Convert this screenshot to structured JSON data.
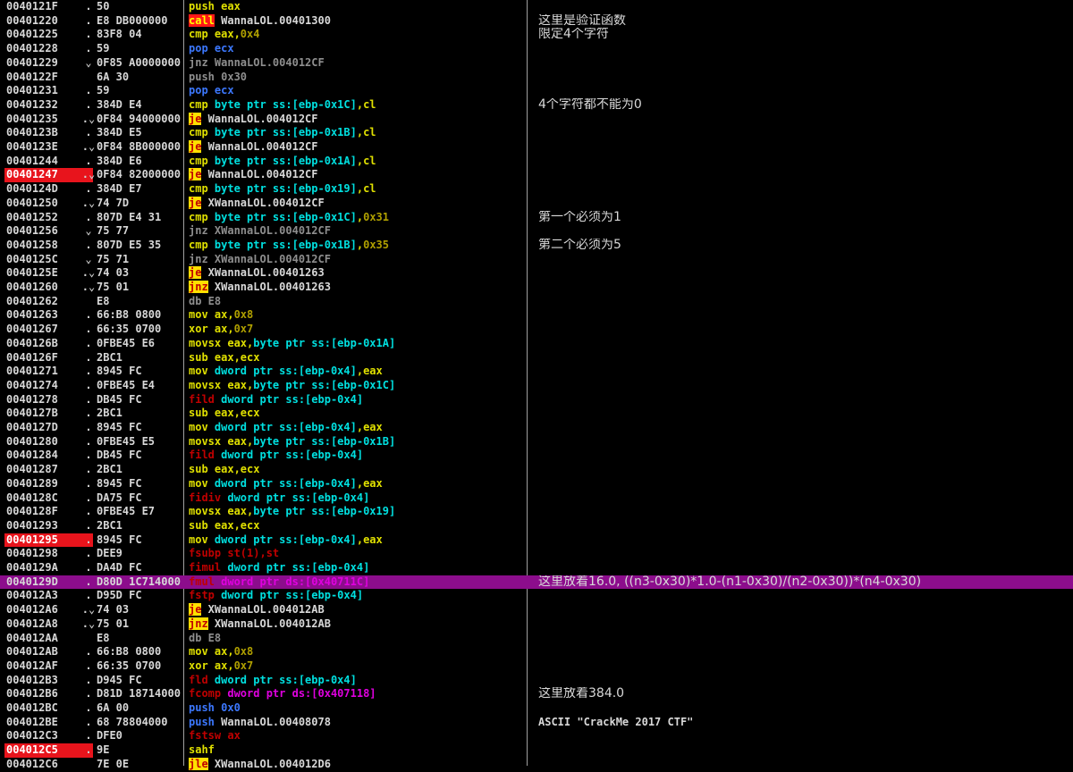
{
  "rows": [
    {
      "addr": "0040121F",
      "mark": ".",
      "hex": "50",
      "ins": [
        [
          "c-y",
          "push eax"
        ]
      ],
      "cmt": ""
    },
    {
      "addr": "00401220",
      "mark": ".",
      "hex": "E8 DB000000",
      "ins": [
        [
          "c-call",
          "call"
        ],
        [
          "c-w",
          " WannaLOL.00401300"
        ]
      ],
      "cmt": "这里是验证函数",
      "cjk": true
    },
    {
      "addr": "00401225",
      "mark": ".",
      "hex": "83F8 04",
      "ins": [
        [
          "c-y",
          "cmp eax,"
        ],
        [
          "c-o",
          "0x4"
        ]
      ],
      "cmt": "限定4个字符",
      "cjk": true
    },
    {
      "addr": "00401228",
      "mark": ".",
      "hex": "59",
      "ins": [
        [
          "c-b",
          "pop ecx"
        ]
      ],
      "cmt": ""
    },
    {
      "addr": "00401229",
      "mark": "⌄",
      "hex": "0F85 A0000000",
      "ins": [
        [
          "c-g",
          "jnz WannaLOL.004012CF"
        ]
      ],
      "cmt": ""
    },
    {
      "addr": "0040122F",
      "mark": "",
      "hex": "6A 30",
      "ins": [
        [
          "c-g",
          "push 0x30"
        ]
      ],
      "cmt": ""
    },
    {
      "addr": "00401231",
      "mark": ".",
      "hex": "59",
      "ins": [
        [
          "c-b",
          "pop ecx"
        ]
      ],
      "cmt": ""
    },
    {
      "addr": "00401232",
      "mark": ".",
      "hex": "384D E4",
      "ins": [
        [
          "c-y",
          "cmp "
        ],
        [
          "c-c",
          "byte ptr ss:[ebp-0x1C]"
        ],
        [
          "c-y",
          ",cl"
        ]
      ],
      "cmt": "4个字符都不能为0",
      "cjk": true
    },
    {
      "addr": "00401235",
      "mark": ".⌄",
      "hex": "0F84 94000000",
      "ins": [
        [
          "c-jy",
          "je"
        ],
        [
          "c-w",
          " WannaLOL.004012CF"
        ]
      ],
      "cmt": ""
    },
    {
      "addr": "0040123B",
      "mark": ".",
      "hex": "384D E5",
      "ins": [
        [
          "c-y",
          "cmp "
        ],
        [
          "c-c",
          "byte ptr ss:[ebp-0x1B]"
        ],
        [
          "c-y",
          ",cl"
        ]
      ],
      "cmt": ""
    },
    {
      "addr": "0040123E",
      "mark": ".⌄",
      "hex": "0F84 8B000000",
      "ins": [
        [
          "c-jy",
          "je"
        ],
        [
          "c-w",
          " WannaLOL.004012CF"
        ]
      ],
      "cmt": ""
    },
    {
      "addr": "00401244",
      "mark": ".",
      "hex": "384D E6",
      "ins": [
        [
          "c-y",
          "cmp "
        ],
        [
          "c-c",
          "byte ptr ss:[ebp-0x1A]"
        ],
        [
          "c-y",
          ",cl"
        ]
      ],
      "cmt": ""
    },
    {
      "addr": "00401247",
      "bp": true,
      "mark": ".⌄",
      "hex": "0F84 82000000",
      "ins": [
        [
          "c-jy",
          "je"
        ],
        [
          "c-w",
          " WannaLOL.004012CF"
        ]
      ],
      "cmt": ""
    },
    {
      "addr": "0040124D",
      "mark": ".",
      "hex": "384D E7",
      "ins": [
        [
          "c-y",
          "cmp "
        ],
        [
          "c-c",
          "byte ptr ss:[ebp-0x19]"
        ],
        [
          "c-y",
          ",cl"
        ]
      ],
      "cmt": ""
    },
    {
      "addr": "00401250",
      "mark": ".⌄",
      "hex": "74 7D",
      "ins": [
        [
          "c-jy",
          "je"
        ],
        [
          "c-w",
          " XWannaLOL.004012CF"
        ]
      ],
      "cmt": ""
    },
    {
      "addr": "00401252",
      "mark": ".",
      "hex": "807D E4 31",
      "ins": [
        [
          "c-y",
          "cmp "
        ],
        [
          "c-c",
          "byte ptr ss:[ebp-0x1C]"
        ],
        [
          "c-y",
          ","
        ],
        [
          "c-o",
          "0x31"
        ]
      ],
      "cmt": "第一个必须为1",
      "cjk": true
    },
    {
      "addr": "00401256",
      "mark": "⌄",
      "hex": "75 77",
      "ins": [
        [
          "c-g",
          "jnz XWannaLOL.004012CF"
        ]
      ],
      "cmt": ""
    },
    {
      "addr": "00401258",
      "mark": ".",
      "hex": "807D E5 35",
      "ins": [
        [
          "c-y",
          "cmp "
        ],
        [
          "c-c",
          "byte ptr ss:[ebp-0x1B]"
        ],
        [
          "c-y",
          ","
        ],
        [
          "c-o",
          "0x35"
        ]
      ],
      "cmt": "第二个必须为5",
      "cjk": true
    },
    {
      "addr": "0040125C",
      "mark": "⌄",
      "hex": "75 71",
      "ins": [
        [
          "c-g",
          "jnz XWannaLOL.004012CF"
        ]
      ],
      "cmt": ""
    },
    {
      "addr": "0040125E",
      "mark": ".⌄",
      "hex": "74 03",
      "ins": [
        [
          "c-jy",
          "je"
        ],
        [
          "c-w",
          " XWannaLOL.00401263"
        ]
      ],
      "cmt": ""
    },
    {
      "addr": "00401260",
      "mark": ".⌄",
      "hex": "75 01",
      "ins": [
        [
          "c-jy",
          "jnz"
        ],
        [
          "c-w",
          " XWannaLOL.00401263"
        ]
      ],
      "cmt": ""
    },
    {
      "addr": "00401262",
      "mark": "",
      "hex": "E8",
      "ins": [
        [
          "c-g",
          "db E8"
        ]
      ],
      "cmt": ""
    },
    {
      "addr": "00401263",
      "mark": ".",
      "hex": "66:B8 0800",
      "ins": [
        [
          "c-y",
          "mov ax,"
        ],
        [
          "c-o",
          "0x8"
        ]
      ],
      "cmt": ""
    },
    {
      "addr": "00401267",
      "mark": ".",
      "hex": "66:35 0700",
      "ins": [
        [
          "c-y",
          "xor ax,"
        ],
        [
          "c-o",
          "0x7"
        ]
      ],
      "cmt": ""
    },
    {
      "addr": "0040126B",
      "mark": ".",
      "hex": "0FBE45 E6",
      "ins": [
        [
          "c-y",
          "movsx eax,"
        ],
        [
          "c-c",
          "byte ptr ss:[ebp-0x1A]"
        ]
      ],
      "cmt": ""
    },
    {
      "addr": "0040126F",
      "mark": ".",
      "hex": "2BC1",
      "ins": [
        [
          "c-y",
          "sub eax,ecx"
        ]
      ],
      "cmt": ""
    },
    {
      "addr": "00401271",
      "mark": ".",
      "hex": "8945 FC",
      "ins": [
        [
          "c-y",
          "mov "
        ],
        [
          "c-c",
          "dword ptr ss:[ebp-0x4]"
        ],
        [
          "c-y",
          ",eax"
        ]
      ],
      "cmt": ""
    },
    {
      "addr": "00401274",
      "mark": ".",
      "hex": "0FBE45 E4",
      "ins": [
        [
          "c-y",
          "movsx eax,"
        ],
        [
          "c-c",
          "byte ptr ss:[ebp-0x1C]"
        ]
      ],
      "cmt": ""
    },
    {
      "addr": "00401278",
      "mark": ".",
      "hex": "DB45 FC",
      "ins": [
        [
          "c-r",
          "fild "
        ],
        [
          "c-c",
          "dword ptr ss:[ebp-0x4]"
        ]
      ],
      "cmt": ""
    },
    {
      "addr": "0040127B",
      "mark": ".",
      "hex": "2BC1",
      "ins": [
        [
          "c-y",
          "sub eax,ecx"
        ]
      ],
      "cmt": ""
    },
    {
      "addr": "0040127D",
      "mark": ".",
      "hex": "8945 FC",
      "ins": [
        [
          "c-y",
          "mov "
        ],
        [
          "c-c",
          "dword ptr ss:[ebp-0x4]"
        ],
        [
          "c-y",
          ",eax"
        ]
      ],
      "cmt": ""
    },
    {
      "addr": "00401280",
      "mark": ".",
      "hex": "0FBE45 E5",
      "ins": [
        [
          "c-y",
          "movsx eax,"
        ],
        [
          "c-c",
          "byte ptr ss:[ebp-0x1B]"
        ]
      ],
      "cmt": ""
    },
    {
      "addr": "00401284",
      "mark": ".",
      "hex": "DB45 FC",
      "ins": [
        [
          "c-r",
          "fild "
        ],
        [
          "c-c",
          "dword ptr ss:[ebp-0x4]"
        ]
      ],
      "cmt": ""
    },
    {
      "addr": "00401287",
      "mark": ".",
      "hex": "2BC1",
      "ins": [
        [
          "c-y",
          "sub eax,ecx"
        ]
      ],
      "cmt": ""
    },
    {
      "addr": "00401289",
      "mark": ".",
      "hex": "8945 FC",
      "ins": [
        [
          "c-y",
          "mov "
        ],
        [
          "c-c",
          "dword ptr ss:[ebp-0x4]"
        ],
        [
          "c-y",
          ",eax"
        ]
      ],
      "cmt": ""
    },
    {
      "addr": "0040128C",
      "mark": ".",
      "hex": "DA75 FC",
      "ins": [
        [
          "c-r",
          "fidiv "
        ],
        [
          "c-c",
          "dword ptr ss:[ebp-0x4]"
        ]
      ],
      "cmt": ""
    },
    {
      "addr": "0040128F",
      "mark": ".",
      "hex": "0FBE45 E7",
      "ins": [
        [
          "c-y",
          "movsx eax,"
        ],
        [
          "c-c",
          "byte ptr ss:[ebp-0x19]"
        ]
      ],
      "cmt": ""
    },
    {
      "addr": "00401293",
      "mark": ".",
      "hex": "2BC1",
      "ins": [
        [
          "c-y",
          "sub eax,ecx"
        ]
      ],
      "cmt": ""
    },
    {
      "addr": "00401295",
      "bp": true,
      "mark": ".",
      "hex": "8945 FC",
      "ins": [
        [
          "c-y",
          "mov "
        ],
        [
          "c-c",
          "dword ptr ss:[ebp-0x4]"
        ],
        [
          "c-y",
          ",eax"
        ]
      ],
      "cmt": ""
    },
    {
      "addr": "00401298",
      "mark": ".",
      "hex": "DEE9",
      "ins": [
        [
          "c-r",
          "fsubp st(1),st"
        ]
      ],
      "cmt": ""
    },
    {
      "addr": "0040129A",
      "mark": ".",
      "hex": "DA4D FC",
      "ins": [
        [
          "c-r",
          "fimul "
        ],
        [
          "c-c",
          "dword ptr ss:[ebp-0x4]"
        ]
      ],
      "cmt": ""
    },
    {
      "addr": "0040129D",
      "sel": true,
      "mark": ".",
      "hex": "D80D 1C714000",
      "ins": [
        [
          "c-r",
          "fmul "
        ],
        [
          "c-m",
          "dword ptr ds:[0x40711C]"
        ]
      ],
      "cmt": "这里放着16.0, ((n3-0x30)*1.0-(n1-0x30)/(n2-0x30))*(n4-0x30)",
      "cjk": true
    },
    {
      "addr": "004012A3",
      "mark": ".",
      "hex": "D95D FC",
      "ins": [
        [
          "c-r",
          "fstp "
        ],
        [
          "c-c",
          "dword ptr ss:[ebp-0x4]"
        ]
      ],
      "cmt": ""
    },
    {
      "addr": "004012A6",
      "mark": ".⌄",
      "hex": "74 03",
      "ins": [
        [
          "c-jy",
          "je"
        ],
        [
          "c-w",
          " XWannaLOL.004012AB"
        ]
      ],
      "cmt": ""
    },
    {
      "addr": "004012A8",
      "mark": ".⌄",
      "hex": "75 01",
      "ins": [
        [
          "c-jy",
          "jnz"
        ],
        [
          "c-w",
          " XWannaLOL.004012AB"
        ]
      ],
      "cmt": ""
    },
    {
      "addr": "004012AA",
      "mark": "",
      "hex": "E8",
      "ins": [
        [
          "c-g",
          "db E8"
        ]
      ],
      "cmt": ""
    },
    {
      "addr": "004012AB",
      "mark": ".",
      "hex": "66:B8 0800",
      "ins": [
        [
          "c-y",
          "mov ax,"
        ],
        [
          "c-o",
          "0x8"
        ]
      ],
      "cmt": ""
    },
    {
      "addr": "004012AF",
      "mark": ".",
      "hex": "66:35 0700",
      "ins": [
        [
          "c-y",
          "xor ax,"
        ],
        [
          "c-o",
          "0x7"
        ]
      ],
      "cmt": ""
    },
    {
      "addr": "004012B3",
      "mark": ".",
      "hex": "D945 FC",
      "ins": [
        [
          "c-r",
          "fld "
        ],
        [
          "c-c",
          "dword ptr ss:[ebp-0x4]"
        ]
      ],
      "cmt": ""
    },
    {
      "addr": "004012B6",
      "mark": ".",
      "hex": "D81D 18714000",
      "ins": [
        [
          "c-r",
          "fcomp "
        ],
        [
          "c-m",
          "dword ptr ds:[0x407118]"
        ]
      ],
      "cmt": "这里放着384.0",
      "cjk": true
    },
    {
      "addr": "004012BC",
      "mark": ".",
      "hex": "6A 00",
      "ins": [
        [
          "c-b",
          "push 0x0"
        ]
      ],
      "cmt": ""
    },
    {
      "addr": "004012BE",
      "mark": ".",
      "hex": "68 78804000",
      "ins": [
        [
          "c-b",
          "push "
        ],
        [
          "c-w",
          "WannaLOL.00408078"
        ]
      ],
      "cmt": "ASCII \"CrackMe 2017 CTF\""
    },
    {
      "addr": "004012C3",
      "mark": ".",
      "hex": "DFE0",
      "ins": [
        [
          "c-r",
          "fstsw ax"
        ]
      ],
      "cmt": ""
    },
    {
      "addr": "004012C5",
      "bp": true,
      "mark": ".",
      "hex": "9E",
      "ins": [
        [
          "c-y",
          "sahf"
        ]
      ],
      "cmt": ""
    },
    {
      "addr": "004012C6",
      "mark": "",
      "hex": "7E 0E",
      "ins": [
        [
          "c-jy",
          "jle"
        ],
        [
          "c-w",
          " XWannaLOL.004012D6"
        ]
      ],
      "cmt": ""
    }
  ]
}
